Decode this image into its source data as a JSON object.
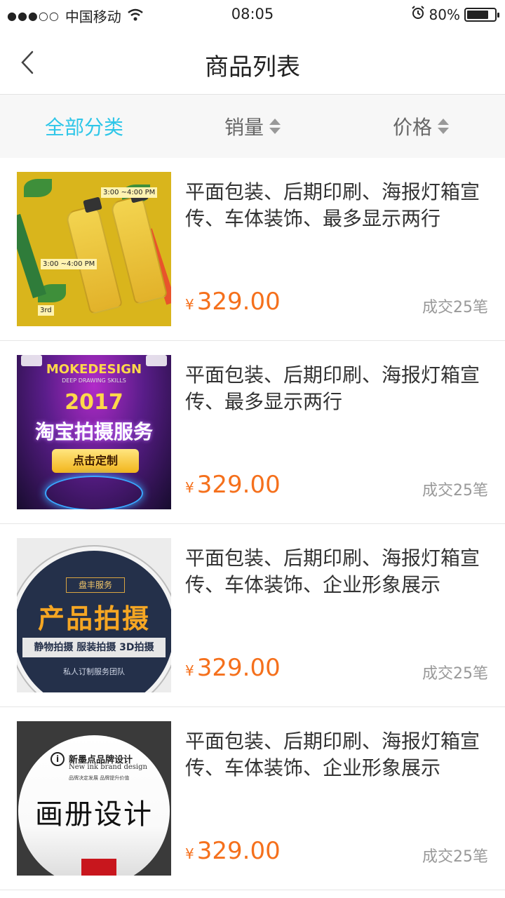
{
  "status_bar": {
    "signal": "●●●○○",
    "carrier": "中国移动",
    "time": "08:05",
    "battery_percent": "80%",
    "battery_level": 0.8
  },
  "nav": {
    "title": "商品列表"
  },
  "filters": [
    {
      "label": "全部分类",
      "active": true,
      "sortable": false
    },
    {
      "label": "销量",
      "active": false,
      "sortable": true
    },
    {
      "label": "价格",
      "active": false,
      "sortable": true
    }
  ],
  "colors": {
    "accent": "#2ec6e8",
    "price": "#f5701c"
  },
  "products": [
    {
      "title": "平面包装、后期印刷、海报灯箱宣传、车体装饰、最多显示两行",
      "currency": "¥",
      "price": "329.00",
      "sales": "成交25笔",
      "thumb": {
        "tags": [
          "3:00 ~4:00 PM",
          "3:00 ~4:00 PM",
          "3rd"
        ]
      }
    },
    {
      "title": "平面包装、后期印刷、海报灯箱宣传、最多显示两行",
      "currency": "¥",
      "price": "329.00",
      "sales": "成交25笔",
      "thumb": {
        "brand": "MOKEDESIGN",
        "sub": "DEEP DRAWING SKILLS",
        "year": "2017",
        "main": "淘宝拍摄服务",
        "button": "点击定制"
      }
    },
    {
      "title": "平面包装、后期印刷、海报灯箱宣传、车体装饰、企业形象展示",
      "currency": "¥",
      "price": "329.00",
      "sales": "成交25笔",
      "thumb": {
        "tagline": "盘丰服务",
        "big": "产品拍摄",
        "band": "静物拍摄  服装拍摄  3D拍摄",
        "small": "私人订制服务团队"
      }
    },
    {
      "title": "平面包装、后期印刷、海报灯箱宣传、车体装饰、企业形象展示",
      "currency": "¥",
      "price": "329.00",
      "sales": "成交25笔",
      "thumb": {
        "logo": "i",
        "name": "新墨点品牌设计",
        "en": "New ink brand design",
        "tiny": "品牌决定发展  品牌提升价值",
        "big": "画册设计"
      }
    }
  ]
}
